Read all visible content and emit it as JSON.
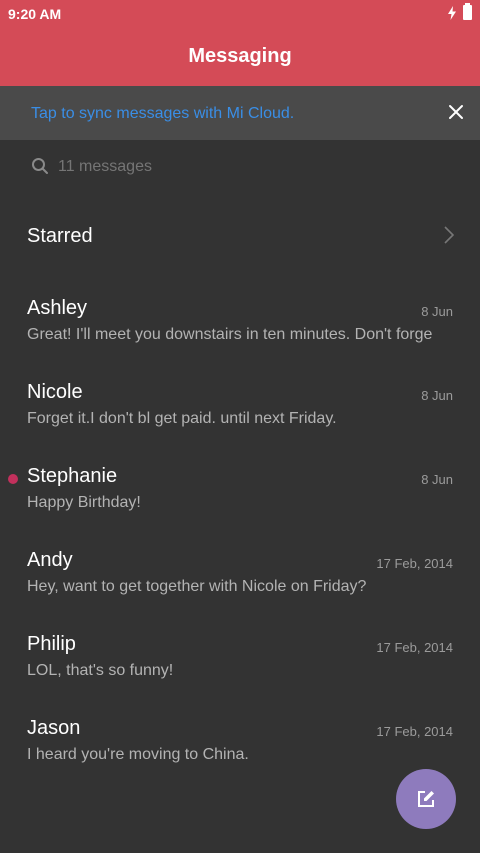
{
  "status_bar": {
    "time": "9:20 AM"
  },
  "app_bar": {
    "title": "Messaging"
  },
  "sync_banner": {
    "text": "Tap to sync messages with Mi Cloud."
  },
  "search": {
    "placeholder": "11 messages"
  },
  "starred": {
    "label": "Starred"
  },
  "conversations": [
    {
      "name": "Ashley",
      "date": "8 Jun",
      "preview": "Great! I'll meet you downstairs in ten minutes. Don't forge",
      "unread": false
    },
    {
      "name": "Nicole",
      "date": "8 Jun",
      "preview": "Forget it.I don't bl get paid. until next Friday.",
      "unread": false
    },
    {
      "name": "Stephanie",
      "date": "8 Jun",
      "preview": "Happy Birthday!",
      "unread": true
    },
    {
      "name": "Andy",
      "date": "17 Feb, 2014",
      "preview": "Hey, want to get together with Nicole on Friday?",
      "unread": false
    },
    {
      "name": "Philip",
      "date": "17 Feb, 2014",
      "preview": "LOL, that's so funny!",
      "unread": false
    },
    {
      "name": "Jason",
      "date": "17 Feb, 2014",
      "preview": "I heard you're moving to China.",
      "unread": false
    }
  ],
  "colors": {
    "header": "#d44b57",
    "banner": "#4a4a4a",
    "background": "#333333",
    "link": "#3a8ee6",
    "unread_dot": "#c2305c",
    "fab": "#8e7bbd"
  },
  "icons": {
    "charging": "charging-bolt-icon",
    "battery": "battery-icon",
    "close": "close-icon",
    "search": "search-icon",
    "chevron": "chevron-right-icon",
    "compose": "compose-icon"
  }
}
